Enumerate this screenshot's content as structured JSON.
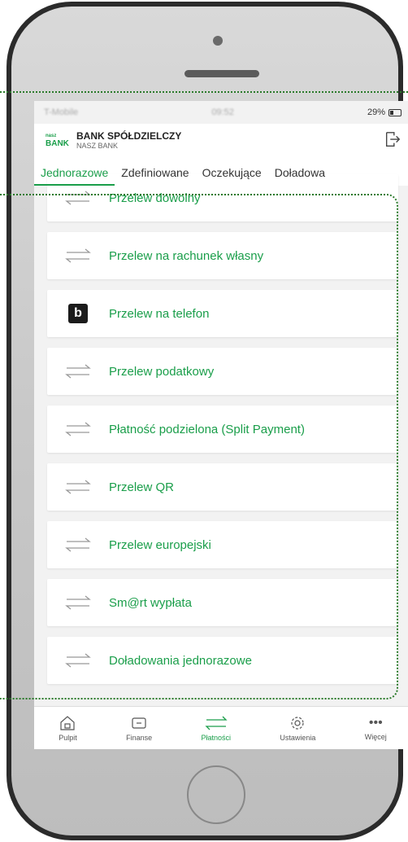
{
  "status": {
    "carrier": "T-Mobile",
    "time": "09:52",
    "battery": "29%"
  },
  "bank": {
    "logo_mark": "BANK",
    "logo_small": "nasz",
    "name": "BANK SPÓŁDZIELCZY",
    "sub": "NASZ BANK"
  },
  "tabs": [
    "Jednorazowe",
    "Zdefiniowane",
    "Oczekujące",
    "Doładowa"
  ],
  "items": [
    {
      "label": "Przelew dowolny",
      "icon": "arrows-icon"
    },
    {
      "label": "Przelew na rachunek własny",
      "icon": "arrows-icon"
    },
    {
      "label": "Przelew na telefon",
      "icon": "blik-icon"
    },
    {
      "label": "Przelew podatkowy",
      "icon": "arrows-icon"
    },
    {
      "label": "Płatność podzielona (Split Payment)",
      "icon": "arrows-icon"
    },
    {
      "label": "Przelew QR",
      "icon": "arrows-icon"
    },
    {
      "label": "Przelew europejski",
      "icon": "arrows-icon"
    },
    {
      "label": "Sm@rt wypłata",
      "icon": "arrows-icon"
    },
    {
      "label": "Doładowania jednorazowe",
      "icon": "arrows-icon"
    }
  ],
  "bottom": [
    "Pulpit",
    "Finanse",
    "Płatności",
    "Ustawienia",
    "Więcej"
  ],
  "colors": {
    "accent": "#1a9e4a",
    "annotation": "#2a7a2a"
  }
}
